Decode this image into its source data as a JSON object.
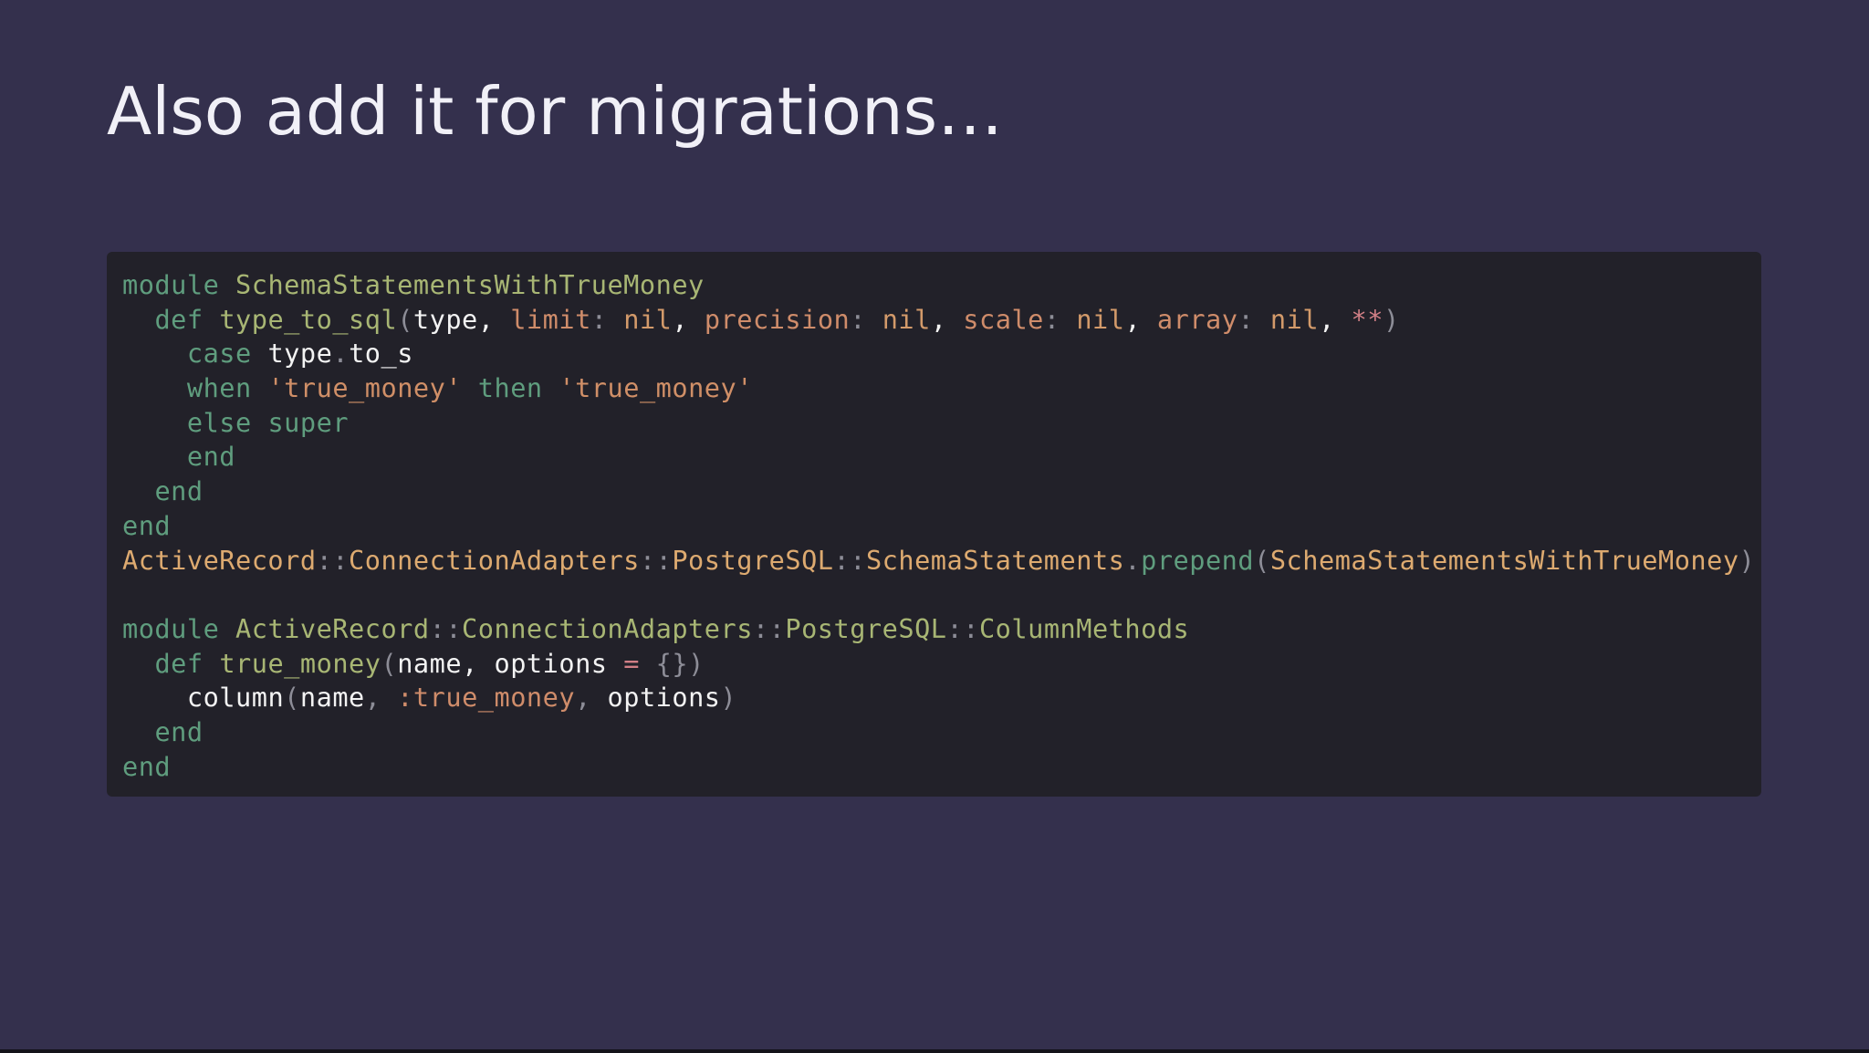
{
  "slide": {
    "title": "Also add it for migrations…"
  },
  "colors": {
    "background": "#34304d",
    "code_background": "#222129",
    "keyword": "#5f9d7e",
    "module_name": "#a8b674",
    "constant": "#ddaa70",
    "symbol_or_string": "#cf8c6a",
    "operator": "#d27f86",
    "punctuation": "#8d8d97",
    "identifier": "#f3f3f3"
  },
  "code": {
    "language": "ruby",
    "lines": [
      [
        {
          "t": "module",
          "c": "kw"
        },
        {
          "t": " ",
          "c": "ident"
        },
        {
          "t": "SchemaStatementsWithTrueMoney",
          "c": "mod"
        }
      ],
      [
        {
          "t": "  ",
          "c": "ident"
        },
        {
          "t": "def",
          "c": "kw"
        },
        {
          "t": " ",
          "c": "ident"
        },
        {
          "t": "type_to_sql",
          "c": "mod"
        },
        {
          "t": "(",
          "c": "punc"
        },
        {
          "t": "type",
          "c": "ident"
        },
        {
          "t": ", ",
          "c": "ident"
        },
        {
          "t": "limit",
          "c": "sym"
        },
        {
          "t": ":",
          "c": "punc"
        },
        {
          "t": " ",
          "c": "ident"
        },
        {
          "t": "nil",
          "c": "nil"
        },
        {
          "t": ", ",
          "c": "ident"
        },
        {
          "t": "precision",
          "c": "sym"
        },
        {
          "t": ":",
          "c": "punc"
        },
        {
          "t": " ",
          "c": "ident"
        },
        {
          "t": "nil",
          "c": "nil"
        },
        {
          "t": ", ",
          "c": "ident"
        },
        {
          "t": "scale",
          "c": "sym"
        },
        {
          "t": ":",
          "c": "punc"
        },
        {
          "t": " ",
          "c": "ident"
        },
        {
          "t": "nil",
          "c": "nil"
        },
        {
          "t": ", ",
          "c": "ident"
        },
        {
          "t": "array",
          "c": "sym"
        },
        {
          "t": ":",
          "c": "punc"
        },
        {
          "t": " ",
          "c": "ident"
        },
        {
          "t": "nil",
          "c": "nil"
        },
        {
          "t": ", ",
          "c": "ident"
        },
        {
          "t": "**",
          "c": "op"
        },
        {
          "t": ")",
          "c": "punc"
        }
      ],
      [
        {
          "t": "    ",
          "c": "ident"
        },
        {
          "t": "case",
          "c": "kw"
        },
        {
          "t": " ",
          "c": "ident"
        },
        {
          "t": "type",
          "c": "ident"
        },
        {
          "t": ".",
          "c": "punc"
        },
        {
          "t": "to_s",
          "c": "ident"
        }
      ],
      [
        {
          "t": "    ",
          "c": "ident"
        },
        {
          "t": "when",
          "c": "kw"
        },
        {
          "t": " ",
          "c": "ident"
        },
        {
          "t": "'true_money'",
          "c": "str"
        },
        {
          "t": " ",
          "c": "ident"
        },
        {
          "t": "then",
          "c": "kw"
        },
        {
          "t": " ",
          "c": "ident"
        },
        {
          "t": "'true_money'",
          "c": "str"
        }
      ],
      [
        {
          "t": "    ",
          "c": "ident"
        },
        {
          "t": "else",
          "c": "kw"
        },
        {
          "t": " ",
          "c": "ident"
        },
        {
          "t": "super",
          "c": "kw"
        }
      ],
      [
        {
          "t": "    ",
          "c": "ident"
        },
        {
          "t": "end",
          "c": "kw"
        }
      ],
      [
        {
          "t": "  ",
          "c": "ident"
        },
        {
          "t": "end",
          "c": "kw"
        }
      ],
      [
        {
          "t": "end",
          "c": "kw"
        }
      ],
      [
        {
          "t": "ActiveRecord",
          "c": "const"
        },
        {
          "t": "::",
          "c": "punc"
        },
        {
          "t": "ConnectionAdapters",
          "c": "const"
        },
        {
          "t": "::",
          "c": "punc"
        },
        {
          "t": "PostgreSQL",
          "c": "const"
        },
        {
          "t": "::",
          "c": "punc"
        },
        {
          "t": "SchemaStatements",
          "c": "const"
        },
        {
          "t": ".",
          "c": "punc"
        },
        {
          "t": "prepend",
          "c": "kw"
        },
        {
          "t": "(",
          "c": "punc"
        },
        {
          "t": "SchemaStatementsWithTrueMoney",
          "c": "const"
        },
        {
          "t": ")",
          "c": "punc"
        }
      ],
      [],
      [
        {
          "t": "module",
          "c": "kw"
        },
        {
          "t": " ",
          "c": "ident"
        },
        {
          "t": "ActiveRecord",
          "c": "mod"
        },
        {
          "t": "::",
          "c": "punc"
        },
        {
          "t": "ConnectionAdapters",
          "c": "mod"
        },
        {
          "t": "::",
          "c": "punc"
        },
        {
          "t": "PostgreSQL",
          "c": "mod"
        },
        {
          "t": "::",
          "c": "punc"
        },
        {
          "t": "ColumnMethods",
          "c": "mod"
        }
      ],
      [
        {
          "t": "  ",
          "c": "ident"
        },
        {
          "t": "def",
          "c": "kw"
        },
        {
          "t": " ",
          "c": "ident"
        },
        {
          "t": "true_money",
          "c": "mod"
        },
        {
          "t": "(",
          "c": "punc"
        },
        {
          "t": "name",
          "c": "ident"
        },
        {
          "t": ", ",
          "c": "ident"
        },
        {
          "t": "options",
          "c": "ident"
        },
        {
          "t": " ",
          "c": "ident"
        },
        {
          "t": "=",
          "c": "op"
        },
        {
          "t": " ",
          "c": "ident"
        },
        {
          "t": "{})",
          "c": "punc"
        }
      ],
      [
        {
          "t": "    ",
          "c": "ident"
        },
        {
          "t": "column",
          "c": "ident"
        },
        {
          "t": "(",
          "c": "punc"
        },
        {
          "t": "name",
          "c": "ident"
        },
        {
          "t": ", ",
          "c": "punc"
        },
        {
          "t": ":true_money",
          "c": "sym"
        },
        {
          "t": ", ",
          "c": "punc"
        },
        {
          "t": "options",
          "c": "ident"
        },
        {
          "t": ")",
          "c": "punc"
        }
      ],
      [
        {
          "t": "  ",
          "c": "ident"
        },
        {
          "t": "end",
          "c": "kw"
        }
      ],
      [
        {
          "t": "end",
          "c": "kw"
        }
      ]
    ]
  }
}
